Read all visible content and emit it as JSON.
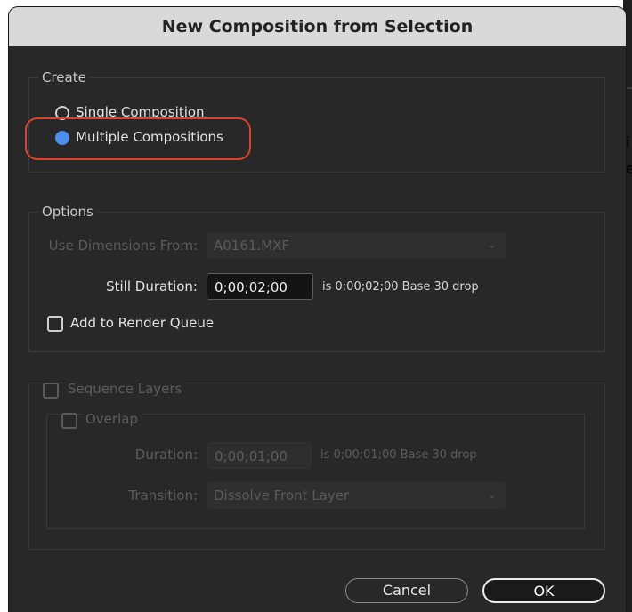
{
  "dialog": {
    "title": "New Composition from Selection"
  },
  "background_fragments": [
    "i",
    "e"
  ],
  "create": {
    "legend": "Create",
    "options": [
      "Single Composition",
      "Multiple Compositions"
    ],
    "selected": "Multiple Compositions"
  },
  "options": {
    "legend": "Options",
    "use_dimensions_label": "Use Dimensions From:",
    "use_dimensions_value": "A0161.MXF",
    "still_duration_label": "Still Duration:",
    "still_duration_value": "0;00;02;00",
    "still_duration_info": "is 0;00;02;00  Base 30   drop",
    "add_to_render_queue": "Add to Render Queue"
  },
  "sequence": {
    "legend": "Sequence Layers",
    "overlap_label": "Overlap",
    "duration_label": "Duration:",
    "duration_value": "0;00;01;00",
    "duration_info": "is 0;00;01;00  Base 30   drop",
    "transition_label": "Transition:",
    "transition_value": "Dissolve Front Layer"
  },
  "buttons": {
    "cancel": "Cancel",
    "ok": "OK"
  },
  "colors": {
    "accent": "#4a8ff0",
    "highlight": "#d9432c"
  }
}
